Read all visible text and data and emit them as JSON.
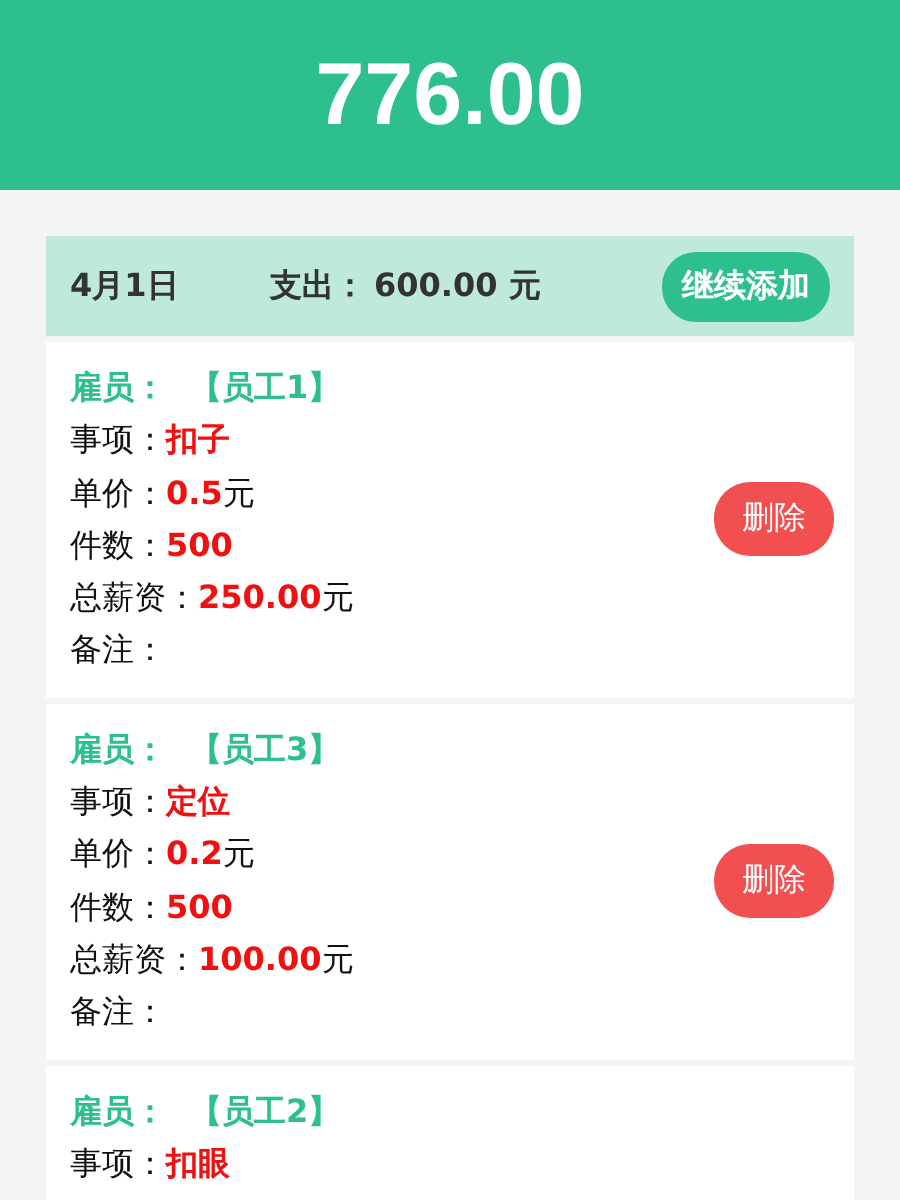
{
  "total": "776.00",
  "day": {
    "date": "4月1日",
    "expense_label": "支出：",
    "expense_value": "600.00 元",
    "add_button": "继续添加"
  },
  "records": [
    {
      "fields": [
        {
          "kind": "employee",
          "label": "雇员：",
          "value": "【员工1】"
        },
        {
          "kind": "detail",
          "label": "事项：",
          "value": "扣子"
        },
        {
          "kind": "detail",
          "label": "单价：",
          "value": "0.5",
          "unit": "元"
        },
        {
          "kind": "detail",
          "label": "件数：",
          "value": "500"
        },
        {
          "kind": "detail",
          "label": "总薪资：",
          "value": "250.00",
          "unit": "元"
        },
        {
          "kind": "detail",
          "label": "备注："
        }
      ],
      "delete_button": "删除"
    },
    {
      "fields": [
        {
          "kind": "employee",
          "label": "雇员：",
          "value": "【员工3】"
        },
        {
          "kind": "detail",
          "label": "事项：",
          "value": "定位"
        },
        {
          "kind": "detail",
          "label": "单价：",
          "value": "0.2",
          "unit": "元"
        },
        {
          "kind": "detail",
          "label": "件数：",
          "value": "500"
        },
        {
          "kind": "detail",
          "label": "总薪资：",
          "value": "100.00",
          "unit": "元"
        },
        {
          "kind": "detail",
          "label": "备注："
        }
      ],
      "delete_button": "删除"
    },
    {
      "fields": [
        {
          "kind": "employee",
          "label": "雇员：",
          "value": "【员工2】"
        },
        {
          "kind": "detail",
          "label": "事项：",
          "value": "扣眼"
        }
      ]
    }
  ]
}
